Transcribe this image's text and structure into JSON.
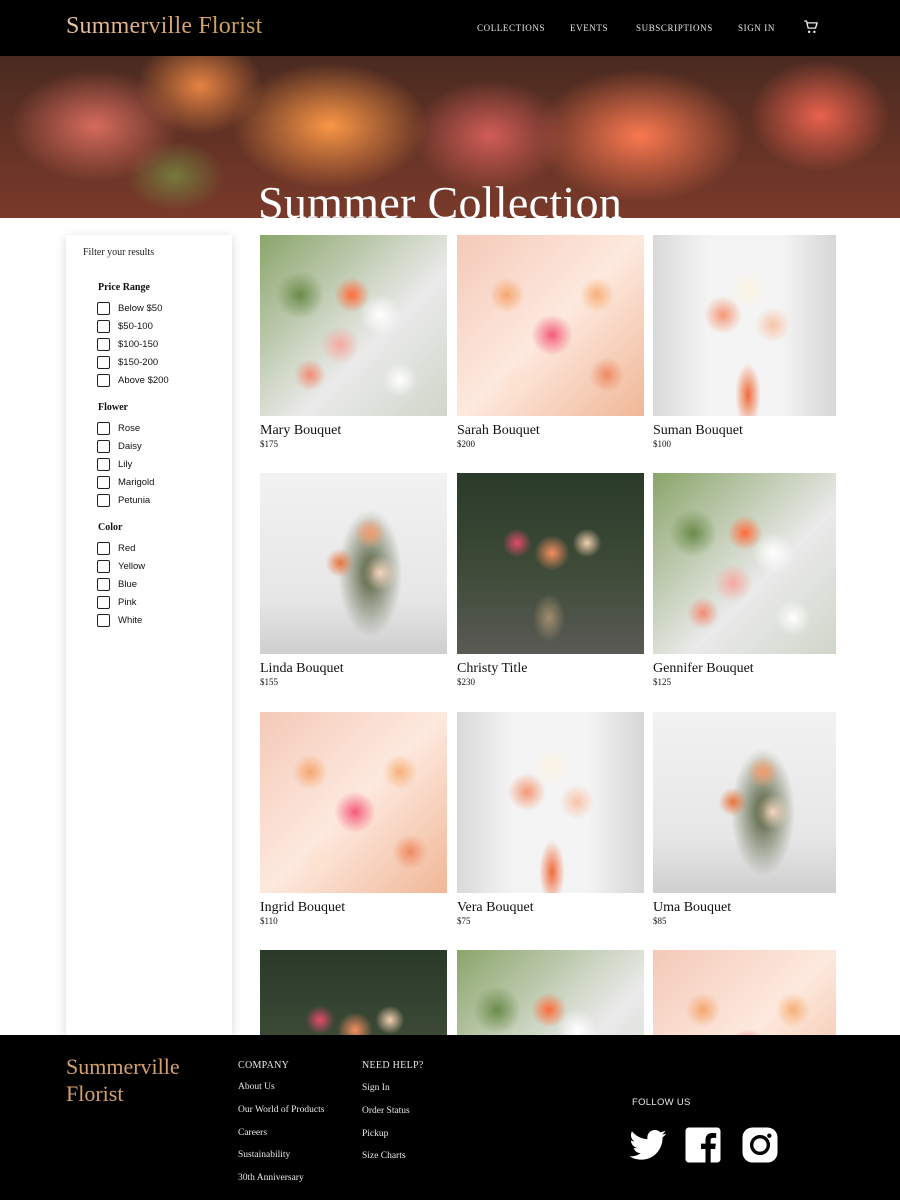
{
  "brand": "Summerville Florist",
  "nav": {
    "collections": "COLLECTIONS",
    "events": "EVENTS",
    "subscriptions": "SUBSCRIPTIONS",
    "sign_in": "SIGN IN",
    "cart_icon": "cart-icon"
  },
  "hero": {
    "title": "Summer Collection"
  },
  "filters": {
    "title": "Filter your results",
    "price": {
      "label": "Price Range",
      "options": [
        "Below $50",
        "$50-100",
        "$100-150",
        "$150-200",
        "Above $200"
      ]
    },
    "flower": {
      "label": "Flower",
      "options": [
        "Rose",
        "Daisy",
        "Lily",
        "Marigold",
        "Petunia"
      ]
    },
    "color": {
      "label": "Color",
      "options": [
        "Red",
        "Yellow",
        "Blue",
        "Pink",
        "White"
      ]
    }
  },
  "products": [
    {
      "name": "Mary Bouquet",
      "price": "$175"
    },
    {
      "name": "Sarah Bouquet",
      "price": "$200"
    },
    {
      "name": "Suman Bouquet",
      "price": "$100"
    },
    {
      "name": "Linda Bouquet",
      "price": "$155"
    },
    {
      "name": "Christy Title",
      "price": "$230"
    },
    {
      "name": "Gennifer Bouquet",
      "price": "$125"
    },
    {
      "name": "Ingrid Bouquet",
      "price": "$110"
    },
    {
      "name": "Vera Bouquet",
      "price": "$75"
    },
    {
      "name": "Uma Bouquet",
      "price": "$85"
    }
  ],
  "footer": {
    "brand": "Summerville Florist",
    "company": {
      "title": "COMPANY",
      "links": [
        "About Us",
        "Our World of Products",
        "Careers",
        "Sustainability",
        "30th Anniversary"
      ]
    },
    "help": {
      "title": "NEED HELP?",
      "links": [
        "Sign In",
        "Order Status",
        "Pickup",
        "Size Charts"
      ]
    },
    "follow": "FOLLOW US",
    "social_icons": [
      "twitter-icon",
      "facebook-icon",
      "instagram-icon"
    ]
  },
  "colors": {
    "header_bg": "#000000",
    "brand_gold": "#d3a06e",
    "footer_bg": "#000000"
  }
}
